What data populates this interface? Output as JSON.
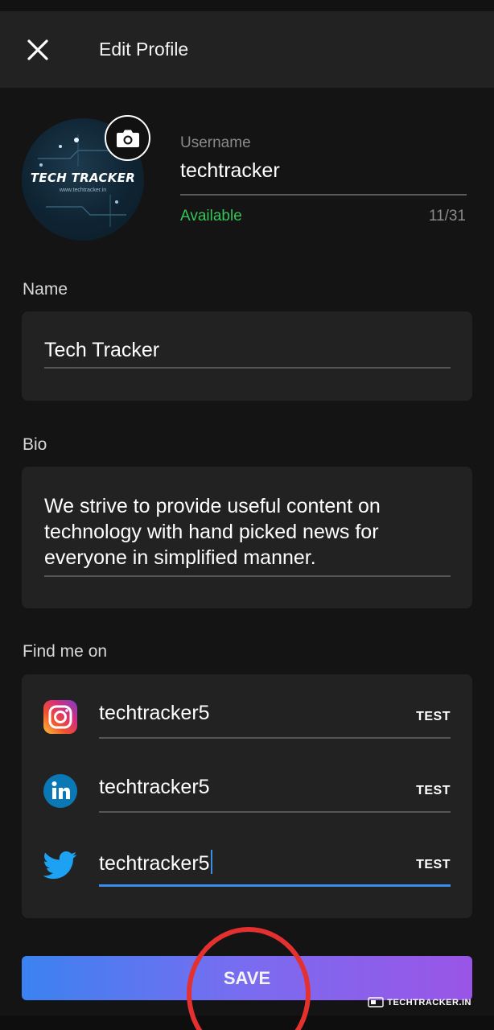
{
  "header": {
    "title": "Edit Profile"
  },
  "avatar": {
    "logo_text": "TECH TRACKER",
    "sub_text": "www.techtracker.in"
  },
  "username": {
    "label": "Username",
    "value": "techtracker",
    "status": "Available",
    "count": "11/31"
  },
  "name_section": {
    "label": "Name",
    "value": "Tech Tracker"
  },
  "bio_section": {
    "label": "Bio",
    "value": "We strive to provide useful content on technology with hand picked news for everyone in simplified manner."
  },
  "find_me": {
    "label": "Find me on",
    "items": [
      {
        "network": "instagram-icon",
        "handle": "techtracker5",
        "action": "TEST"
      },
      {
        "network": "linkedin-icon",
        "handle": "techtracker5",
        "action": "TEST"
      },
      {
        "network": "twitter-icon",
        "handle": "techtracker5",
        "action": "TEST"
      }
    ]
  },
  "save": {
    "label": "SAVE"
  },
  "watermark": {
    "text": "TECHTRACKER.IN"
  },
  "colors": {
    "available": "#36c45a",
    "accent": "#3a8ee8",
    "save_gradient_start": "#3b82f0",
    "save_gradient_end": "#9a55e6",
    "annotation": "#e53030"
  }
}
